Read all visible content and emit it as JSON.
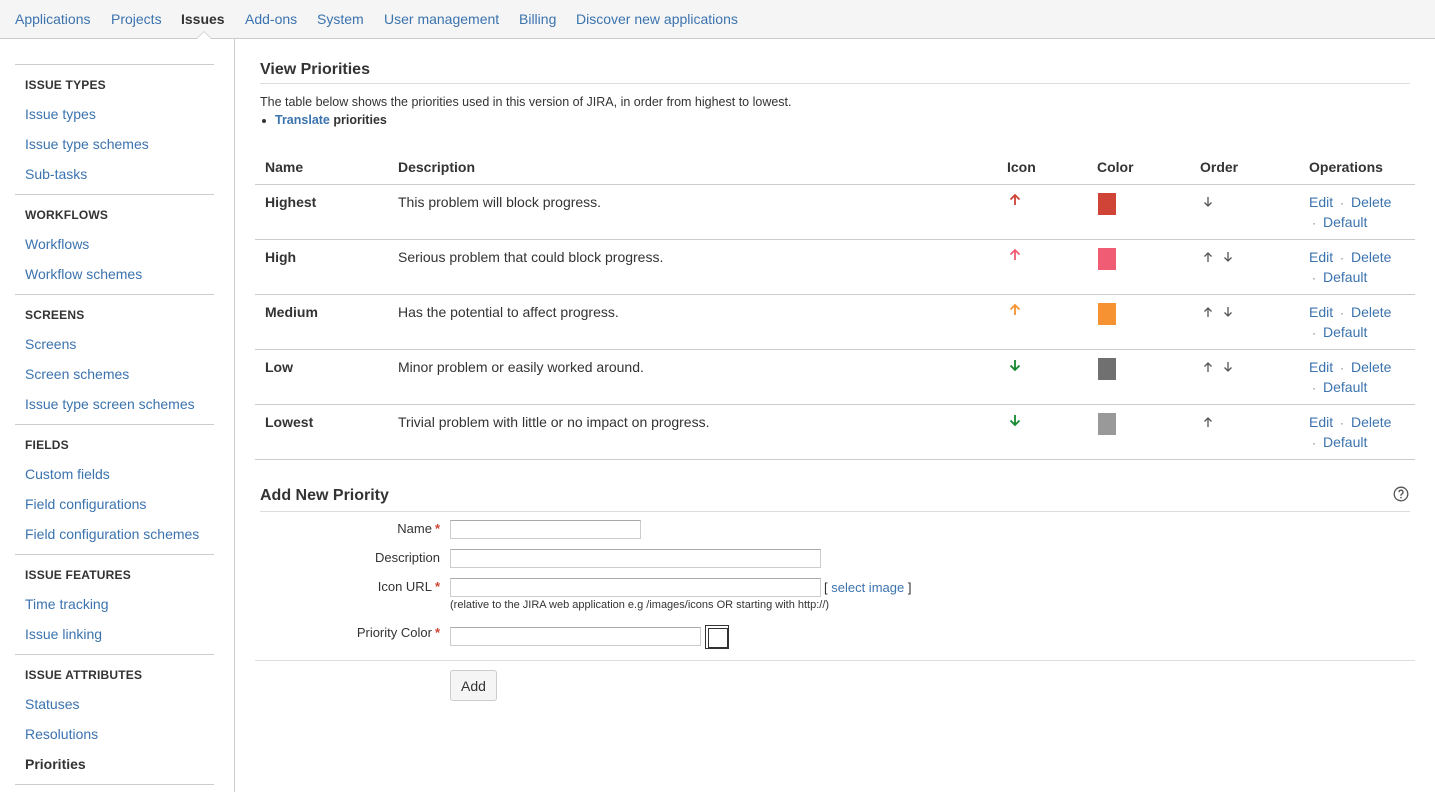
{
  "topnav": {
    "items": [
      "Applications",
      "Projects",
      "Issues",
      "Add-ons",
      "System",
      "User management",
      "Billing",
      "Discover new applications"
    ]
  },
  "sidebar": {
    "sections": [
      {
        "heading": "ISSUE TYPES",
        "links": [
          "Issue types",
          "Issue type schemes",
          "Sub-tasks"
        ]
      },
      {
        "heading": "WORKFLOWS",
        "links": [
          "Workflows",
          "Workflow schemes"
        ]
      },
      {
        "heading": "SCREENS",
        "links": [
          "Screens",
          "Screen schemes",
          "Issue type screen schemes"
        ]
      },
      {
        "heading": "FIELDS",
        "links": [
          "Custom fields",
          "Field configurations",
          "Field configuration schemes"
        ]
      },
      {
        "heading": "ISSUE FEATURES",
        "links": [
          "Time tracking",
          "Issue linking"
        ]
      },
      {
        "heading": "ISSUE ATTRIBUTES",
        "links": [
          "Statuses",
          "Resolutions",
          "Priorities"
        ]
      }
    ]
  },
  "main": {
    "title": "View Priorities",
    "intro": "The table below shows the priorities used in this version of JIRA, in order from highest to lowest.",
    "translate_link": "Translate",
    "translate_rest": " priorities",
    "columns": [
      "Name",
      "Description",
      "Icon",
      "Color",
      "Order",
      "Operations"
    ],
    "ops": {
      "edit": "Edit",
      "delete": "Delete",
      "default": "Default",
      "sep": "·"
    },
    "rows": [
      {
        "name": "Highest",
        "description": "This problem will block progress.",
        "icon": "arrow-up-icon",
        "icon_color": "#d04437",
        "color": "#d04437"
      },
      {
        "name": "High",
        "description": "Serious problem that could block progress.",
        "icon": "arrow-up-icon",
        "icon_color": "#f15c75",
        "color": "#f15c75"
      },
      {
        "name": "Medium",
        "description": "Has the potential to affect progress.",
        "icon": "arrow-up-icon",
        "icon_color": "#f79232",
        "color": "#f79232"
      },
      {
        "name": "Low",
        "description": "Minor problem or easily worked around.",
        "icon": "arrow-down-icon",
        "icon_color": "#14892c",
        "color": "#707070"
      },
      {
        "name": "Lowest",
        "description": "Trivial problem with little or no impact on progress.",
        "icon": "arrow-down-icon",
        "icon_color": "#14892c",
        "color": "#999999"
      }
    ]
  },
  "form": {
    "title": "Add New Priority",
    "name_label": "Name",
    "description_label": "Description",
    "icon_url_label": "Icon URL",
    "select_open": "[ ",
    "select_image": "select image",
    "select_close": " ]",
    "hint": "(relative to the JIRA web application e.g /images/icons OR starting with http://)",
    "color_label": "Priority Color",
    "required_marker": "*",
    "add_button": "Add"
  }
}
